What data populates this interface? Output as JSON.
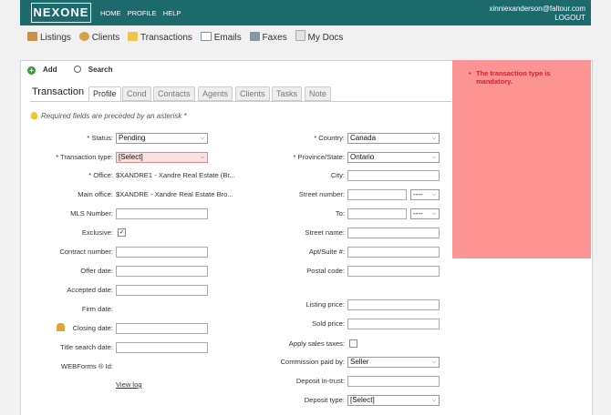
{
  "header": {
    "logo": "NEXONE",
    "nav": [
      "HOME",
      "PROFILE",
      "HELP"
    ],
    "user_email": "xinniexanderson@faltour.com",
    "logout": "LOGOUT"
  },
  "main_nav": [
    {
      "label": "Listings",
      "icon": "house-icon"
    },
    {
      "label": "Clients",
      "icon": "clients-icon"
    },
    {
      "label": "Transactions",
      "icon": "folder-icon"
    },
    {
      "label": "Emails",
      "icon": "envelope-icon"
    },
    {
      "label": "Faxes",
      "icon": "fax-icon"
    },
    {
      "label": "My Docs",
      "icon": "docs-icon"
    }
  ],
  "toolbar": {
    "add": "Add",
    "search": "Search"
  },
  "tabs": {
    "title": "Transaction",
    "items": [
      "Profile",
      "Cond",
      "Contacts",
      "Agents",
      "Clients",
      "Tasks",
      "Note"
    ],
    "active": "Profile"
  },
  "note": "Required fields are preceded by an asterisk *",
  "left": {
    "status_label": "* Status:",
    "status_value": "Pending",
    "type_label": "* Transaction type:",
    "type_value": "[Select]",
    "office_label": "* Office:",
    "office_value": "$XANDRE1 - Xandre Real Estate (Br...",
    "main_office_label": "Main office:",
    "main_office_value": "$XANDRE - Xandre Real Estate Bro...",
    "mls_label": "MLS Number:",
    "exclusive_label": "Exclusive:",
    "contract_label": "Contract number:",
    "offer_label": "Offer date:",
    "accepted_label": "Accepted date:",
    "firm_label": "Firm date:",
    "closing_label": "Closing date:",
    "title_search_label": "Title search date:",
    "webforms_label": "WEBForms ® Id:",
    "view_log": "View log"
  },
  "right": {
    "country_label": "* Country:",
    "country_value": "Canada",
    "province_label": "* Province/State:",
    "province_value": "Ontario",
    "city_label": "City:",
    "street_number_label": "Street number:",
    "street_number_sel": "----",
    "to_label": "To:",
    "to_sel": "----",
    "street_name_label": "Street name:",
    "apt_label": "Apt/Suite #:",
    "postal_label": "Postal code:",
    "listing_price_label": "Listing price:",
    "sold_price_label": "Sold price:",
    "sales_tax_label": "Apply sales taxes:",
    "commission_label": "Commission paid by:",
    "commission_value": "Seller",
    "deposit_trust_label": "Deposit in-trust:",
    "deposit_type_label": "Deposit type:",
    "deposit_type_value": "[Select]"
  },
  "error": {
    "message": "The transaction type is mandatory."
  },
  "colors": {
    "header": "#1d6a6c",
    "error_panel": "#fb9492",
    "error_text": "#d9232a"
  }
}
